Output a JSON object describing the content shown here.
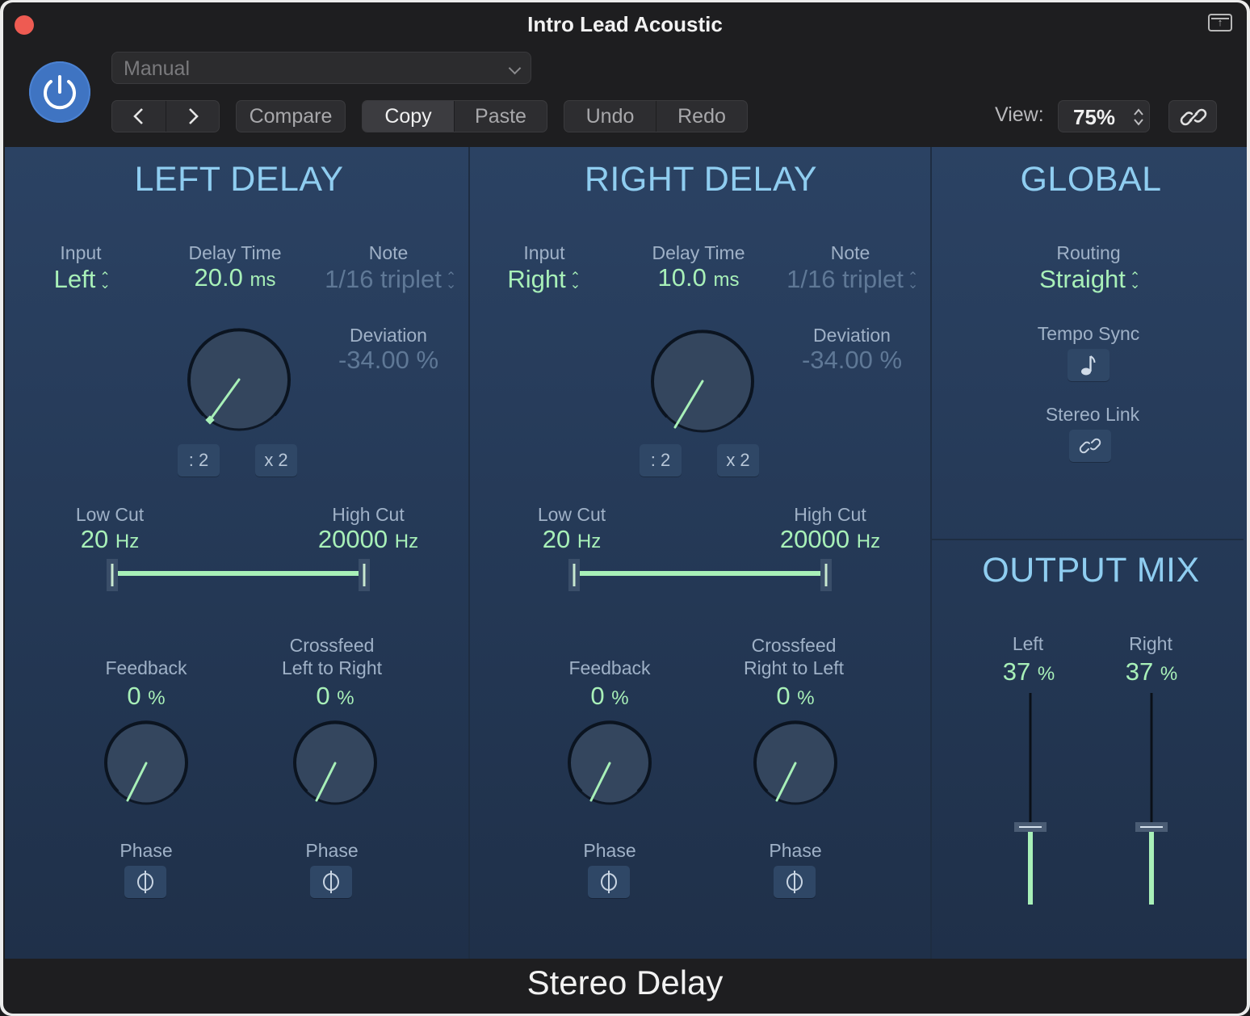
{
  "window": {
    "title": "Intro Lead Acoustic",
    "plugin_name": "Stereo Delay"
  },
  "toolbar": {
    "preset": "Manual",
    "compare": "Compare",
    "copy": "Copy",
    "paste": "Paste",
    "undo": "Undo",
    "redo": "Redo",
    "view_label": "View:",
    "view_value": "75%"
  },
  "left_delay": {
    "title": "LEFT DELAY",
    "input_label": "Input",
    "input_value": "Left",
    "delay_time_label": "Delay Time",
    "delay_time_value": "20.0",
    "delay_time_unit": "ms",
    "note_label": "Note",
    "note_value": "1/16 triplet",
    "deviation_label": "Deviation",
    "deviation_value": "-34.00 %",
    "half_btn": ": 2",
    "double_btn": "x 2",
    "low_cut_label": "Low Cut",
    "low_cut_value": "20",
    "low_cut_unit": "Hz",
    "high_cut_label": "High Cut",
    "high_cut_value": "20000",
    "high_cut_unit": "Hz",
    "feedback_label": "Feedback",
    "feedback_value": "0",
    "feedback_unit": "%",
    "crossfeed_label_1": "Crossfeed",
    "crossfeed_label_2": "Left to Right",
    "crossfeed_value": "0",
    "crossfeed_unit": "%",
    "phase_label": "Phase"
  },
  "right_delay": {
    "title": "RIGHT DELAY",
    "input_label": "Input",
    "input_value": "Right",
    "delay_time_label": "Delay Time",
    "delay_time_value": "10.0",
    "delay_time_unit": "ms",
    "note_label": "Note",
    "note_value": "1/16 triplet",
    "deviation_label": "Deviation",
    "deviation_value": "-34.00 %",
    "half_btn": ": 2",
    "double_btn": "x 2",
    "low_cut_label": "Low Cut",
    "low_cut_value": "20",
    "low_cut_unit": "Hz",
    "high_cut_label": "High Cut",
    "high_cut_value": "20000",
    "high_cut_unit": "Hz",
    "feedback_label": "Feedback",
    "feedback_value": "0",
    "feedback_unit": "%",
    "crossfeed_label_1": "Crossfeed",
    "crossfeed_label_2": "Right to Left",
    "crossfeed_value": "0",
    "crossfeed_unit": "%",
    "phase_label": "Phase"
  },
  "global": {
    "title": "GLOBAL",
    "routing_label": "Routing",
    "routing_value": "Straight",
    "tempo_sync_label": "Tempo Sync",
    "stereo_link_label": "Stereo Link"
  },
  "output_mix": {
    "title": "OUTPUT MIX",
    "left_label": "Left",
    "left_value": "37",
    "left_unit": "%",
    "right_label": "Right",
    "right_value": "37",
    "right_unit": "%"
  },
  "colors": {
    "accent": "#a8f0b8",
    "title": "#8fcdf0",
    "power": "#3f74c2",
    "close": "#ee5b52"
  },
  "icons": [
    "close-icon",
    "expand-icon",
    "power-icon",
    "chevron-down-icon",
    "chevron-left-icon",
    "chevron-right-icon",
    "link-icon",
    "note-icon",
    "phase-icon",
    "updown-arrows-icon"
  ]
}
